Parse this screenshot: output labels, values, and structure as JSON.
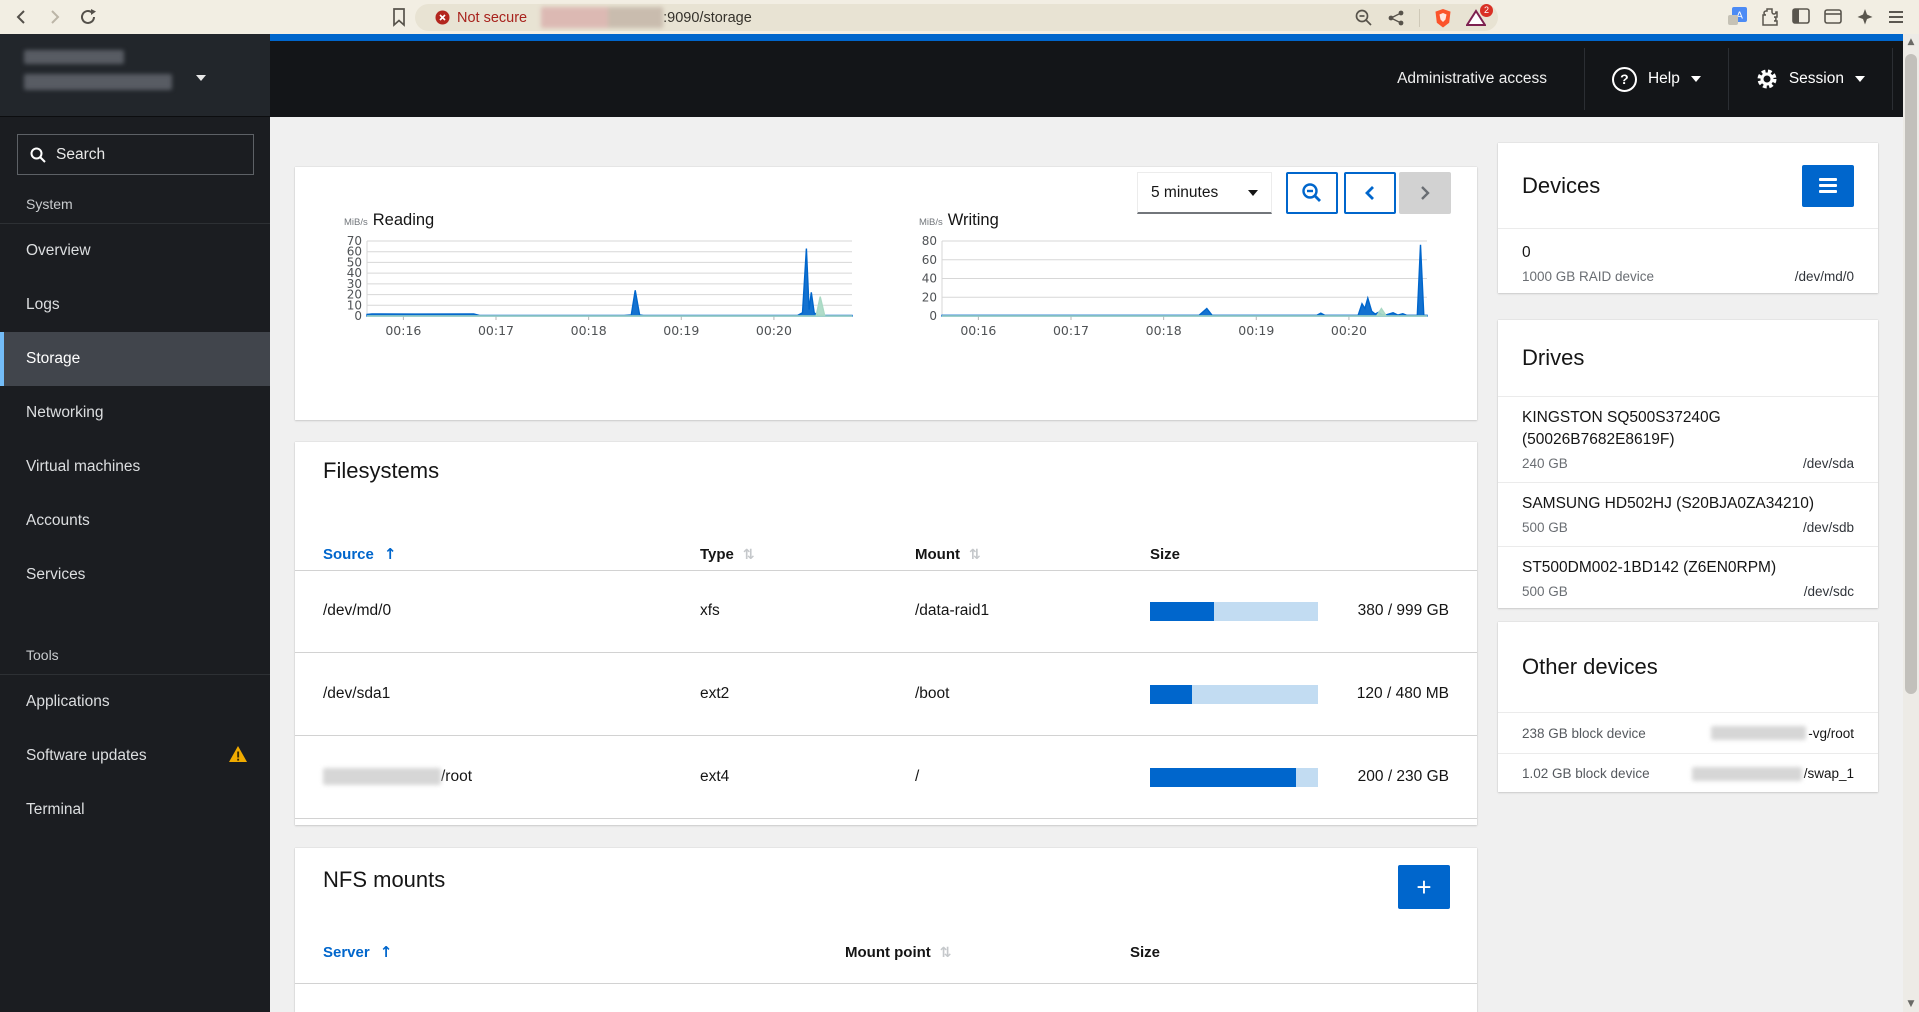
{
  "browser": {
    "not_secure_label": "Not secure",
    "url_suffix": ":9090/storage",
    "extension_badge": "2"
  },
  "masthead": {
    "admin_access": "Administrative access",
    "help_label": "Help",
    "session_label": "Session"
  },
  "sidebar": {
    "search_placeholder": "Search",
    "group1_label": "System",
    "group2_label": "Tools",
    "items1": [
      "Overview",
      "Logs",
      "Storage",
      "Networking",
      "Virtual machines",
      "Accounts",
      "Services"
    ],
    "selected_item": "Storage",
    "items2": [
      "Applications",
      "Software updates",
      "Terminal"
    ]
  },
  "toolbar": {
    "range_value": "5 minutes"
  },
  "filesystems": {
    "title": "Filesystems",
    "headers": {
      "source": "Source",
      "type": "Type",
      "mount": "Mount",
      "size": "Size"
    },
    "rows": [
      {
        "source": "/dev/md/0",
        "type": "xfs",
        "mount": "/data-raid1",
        "size_text": "380 / 999 GB",
        "fraction": 0.38
      },
      {
        "source": "/dev/sda1",
        "type": "ext2",
        "mount": "/boot",
        "size_text": "120 / 480 MB",
        "fraction": 0.25
      },
      {
        "source": "/root",
        "type": "ext4",
        "mount": "/",
        "size_text": "200 / 230 GB",
        "fraction": 0.87,
        "source_redacted_prefix": true
      }
    ]
  },
  "nfs": {
    "title": "NFS mounts",
    "headers": {
      "server": "Server",
      "mount_point": "Mount point",
      "size": "Size"
    },
    "add_label": "+"
  },
  "devices": {
    "title": "Devices",
    "items": [
      {
        "name": "0",
        "desc": "1000 GB RAID device",
        "path": "/dev/md/0"
      }
    ]
  },
  "drives": {
    "title": "Drives",
    "items": [
      {
        "name": "KINGSTON SQ500S37240G (50026B7682E8619F)",
        "size": "240 GB",
        "path": "/dev/sda"
      },
      {
        "name": "SAMSUNG HD502HJ (S20BJA0ZA34210)",
        "size": "500 GB",
        "path": "/dev/sdb"
      },
      {
        "name": "ST500DM002-1BD142 (Z6EN0RPM)",
        "size": "500 GB",
        "path": "/dev/sdc"
      }
    ]
  },
  "other_devices": {
    "title": "Other devices",
    "items": [
      {
        "desc": "238 GB block device",
        "path_suffix": "-vg/root"
      },
      {
        "desc": "1.02 GB block device",
        "path_suffix": "/swap_1"
      }
    ]
  },
  "colors": {
    "accent_blue": "#0066cc",
    "selected_nav_indicator": "#73bcf7",
    "progress_track": "#c2dcf2",
    "warning": "#f0ab00",
    "chart_secondary": "#a9d9c4"
  },
  "chart_data": [
    {
      "type": "area",
      "name": "reading",
      "title": "Reading",
      "unit": "MiB/s",
      "ylim": [
        0,
        70
      ],
      "yticks": [
        0,
        10,
        20,
        30,
        40,
        50,
        60,
        70
      ],
      "x_window": "5-minute window, x given as fraction of plot width (≈00:15.6–00:20.9)",
      "xticks": [
        {
          "pos": 0.075,
          "label": "00:16"
        },
        {
          "pos": 0.266,
          "label": "00:17"
        },
        {
          "pos": 0.457,
          "label": "00:18"
        },
        {
          "pos": 0.648,
          "label": "00:19"
        },
        {
          "pos": 0.839,
          "label": "00:20"
        }
      ],
      "series": [
        {
          "name": "read-primary",
          "color": "#0066cc",
          "points": [
            [
              0,
              1.5
            ],
            [
              0.01,
              2
            ],
            [
              0.1,
              1.8
            ],
            [
              0.22,
              2
            ],
            [
              0.232,
              0.6
            ],
            [
              0.53,
              0.6
            ],
            [
              0.545,
              1
            ],
            [
              0.553,
              24
            ],
            [
              0.562,
              1
            ],
            [
              0.57,
              0.6
            ],
            [
              0.888,
              0.6
            ],
            [
              0.898,
              3
            ],
            [
              0.906,
              63
            ],
            [
              0.9115,
              6
            ],
            [
              0.916,
              22
            ],
            [
              0.922,
              3
            ],
            [
              0.93,
              0.6
            ],
            [
              1,
              0.6
            ]
          ]
        },
        {
          "name": "read-secondary",
          "color": "#a9d9c4",
          "points": [
            [
              0.926,
              0
            ],
            [
              0.9345,
              18
            ],
            [
              0.944,
              0
            ]
          ]
        }
      ]
    },
    {
      "type": "area",
      "name": "writing",
      "title": "Writing",
      "unit": "MiB/s",
      "ylim": [
        0,
        80
      ],
      "yticks": [
        0,
        20,
        40,
        60,
        80
      ],
      "x_window": "5-minute window, x given as fraction of plot width (≈00:15.6–00:20.9)",
      "xticks": [
        {
          "pos": 0.075,
          "label": "00:16"
        },
        {
          "pos": 0.266,
          "label": "00:17"
        },
        {
          "pos": 0.457,
          "label": "00:18"
        },
        {
          "pos": 0.648,
          "label": "00:19"
        },
        {
          "pos": 0.839,
          "label": "00:20"
        }
      ],
      "series": [
        {
          "name": "write-primary",
          "color": "#0066cc",
          "points": [
            [
              0,
              0.8
            ],
            [
              0.53,
              0.8
            ],
            [
              0.546,
              8
            ],
            [
              0.557,
              0.8
            ],
            [
              0.773,
              0.8
            ],
            [
              0.781,
              3
            ],
            [
              0.789,
              0.8
            ],
            [
              0.858,
              0.8
            ],
            [
              0.866,
              13
            ],
            [
              0.872,
              8
            ],
            [
              0.878,
              19
            ],
            [
              0.886,
              5
            ],
            [
              0.893,
              2
            ],
            [
              0.9,
              4
            ],
            [
              0.908,
              1
            ],
            [
              0.918,
              1.5
            ],
            [
              0.93,
              3.5
            ],
            [
              0.94,
              1
            ],
            [
              0.95,
              2.5
            ],
            [
              0.958,
              0.8
            ],
            [
              0.98,
              0.8
            ],
            [
              0.9865,
              76
            ],
            [
              0.9935,
              0.8
            ],
            [
              1,
              0.8
            ]
          ]
        },
        {
          "name": "write-secondary",
          "color": "#a9d9c4",
          "points": [
            [
              0.896,
              0
            ],
            [
              0.906,
              8
            ],
            [
              0.916,
              0
            ]
          ]
        }
      ]
    }
  ]
}
